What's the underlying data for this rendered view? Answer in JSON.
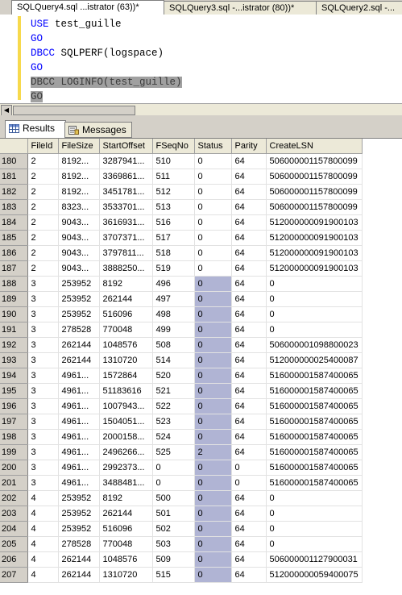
{
  "tabs": [
    {
      "label": "SQLQuery4.sql ...istrator (63))*"
    },
    {
      "label": "SQLQuery3.sql -...istrator (80))*"
    },
    {
      "label": "SQLQuery2.sql -..."
    }
  ],
  "editor": {
    "lines": [
      {
        "kw": "USE",
        "rest": " test_guille"
      },
      {
        "kw": "GO",
        "rest": ""
      },
      {
        "kw": "DBCC",
        "rest": " SQLPERF(logspace)"
      },
      {
        "kw": "GO",
        "rest": ""
      },
      {
        "kw": "DBCC",
        "rest": " LOGINFO(test_guille)"
      },
      {
        "kw": "GO",
        "rest": ""
      }
    ]
  },
  "result_tabs": {
    "results": "Results",
    "messages": "Messages"
  },
  "grid": {
    "columns": [
      "FileId",
      "FileSize",
      "StartOffset",
      "FSeqNo",
      "Status",
      "Parity",
      "CreateLSN"
    ],
    "rows": [
      [
        "180",
        "2",
        "8192...",
        "3287941...",
        "510",
        "0",
        "64",
        "506000001157800099"
      ],
      [
        "181",
        "2",
        "8192...",
        "3369861...",
        "511",
        "0",
        "64",
        "506000001157800099"
      ],
      [
        "182",
        "2",
        "8192...",
        "3451781...",
        "512",
        "0",
        "64",
        "506000001157800099"
      ],
      [
        "183",
        "2",
        "8323...",
        "3533701...",
        "513",
        "0",
        "64",
        "506000001157800099"
      ],
      [
        "184",
        "2",
        "9043...",
        "3616931...",
        "516",
        "0",
        "64",
        "512000000091900103"
      ],
      [
        "185",
        "2",
        "9043...",
        "3707371...",
        "517",
        "0",
        "64",
        "512000000091900103"
      ],
      [
        "186",
        "2",
        "9043...",
        "3797811...",
        "518",
        "0",
        "64",
        "512000000091900103"
      ],
      [
        "187",
        "2",
        "9043...",
        "3888250...",
        "519",
        "0",
        "64",
        "512000000091900103"
      ],
      [
        "188",
        "3",
        "253952",
        "8192",
        "496",
        "0",
        "64",
        "0"
      ],
      [
        "189",
        "3",
        "253952",
        "262144",
        "497",
        "0",
        "64",
        "0"
      ],
      [
        "190",
        "3",
        "253952",
        "516096",
        "498",
        "0",
        "64",
        "0"
      ],
      [
        "191",
        "3",
        "278528",
        "770048",
        "499",
        "0",
        "64",
        "0"
      ],
      [
        "192",
        "3",
        "262144",
        "1048576",
        "508",
        "0",
        "64",
        "506000001098800023"
      ],
      [
        "193",
        "3",
        "262144",
        "1310720",
        "514",
        "0",
        "64",
        "512000000025400087"
      ],
      [
        "194",
        "3",
        "4961...",
        "1572864",
        "520",
        "0",
        "64",
        "516000001587400065"
      ],
      [
        "195",
        "3",
        "4961...",
        "51183616",
        "521",
        "0",
        "64",
        "516000001587400065"
      ],
      [
        "196",
        "3",
        "4961...",
        "1007943...",
        "522",
        "0",
        "64",
        "516000001587400065"
      ],
      [
        "197",
        "3",
        "4961...",
        "1504051...",
        "523",
        "0",
        "64",
        "516000001587400065"
      ],
      [
        "198",
        "3",
        "4961...",
        "2000158...",
        "524",
        "0",
        "64",
        "516000001587400065"
      ],
      [
        "199",
        "3",
        "4961...",
        "2496266...",
        "525",
        "2",
        "64",
        "516000001587400065"
      ],
      [
        "200",
        "3",
        "4961...",
        "2992373...",
        "0",
        "0",
        "0",
        "516000001587400065"
      ],
      [
        "201",
        "3",
        "4961...",
        "3488481...",
        "0",
        "0",
        "0",
        "516000001587400065"
      ],
      [
        "202",
        "4",
        "253952",
        "8192",
        "500",
        "0",
        "64",
        "0"
      ],
      [
        "203",
        "4",
        "253952",
        "262144",
        "501",
        "0",
        "64",
        "0"
      ],
      [
        "204",
        "4",
        "253952",
        "516096",
        "502",
        "0",
        "64",
        "0"
      ],
      [
        "205",
        "4",
        "278528",
        "770048",
        "503",
        "0",
        "64",
        "0"
      ],
      [
        "206",
        "4",
        "262144",
        "1048576",
        "509",
        "0",
        "64",
        "506000001127900031"
      ],
      [
        "207",
        "4",
        "262144",
        "1310720",
        "515",
        "0",
        "64",
        "512000000059400075"
      ]
    ]
  }
}
